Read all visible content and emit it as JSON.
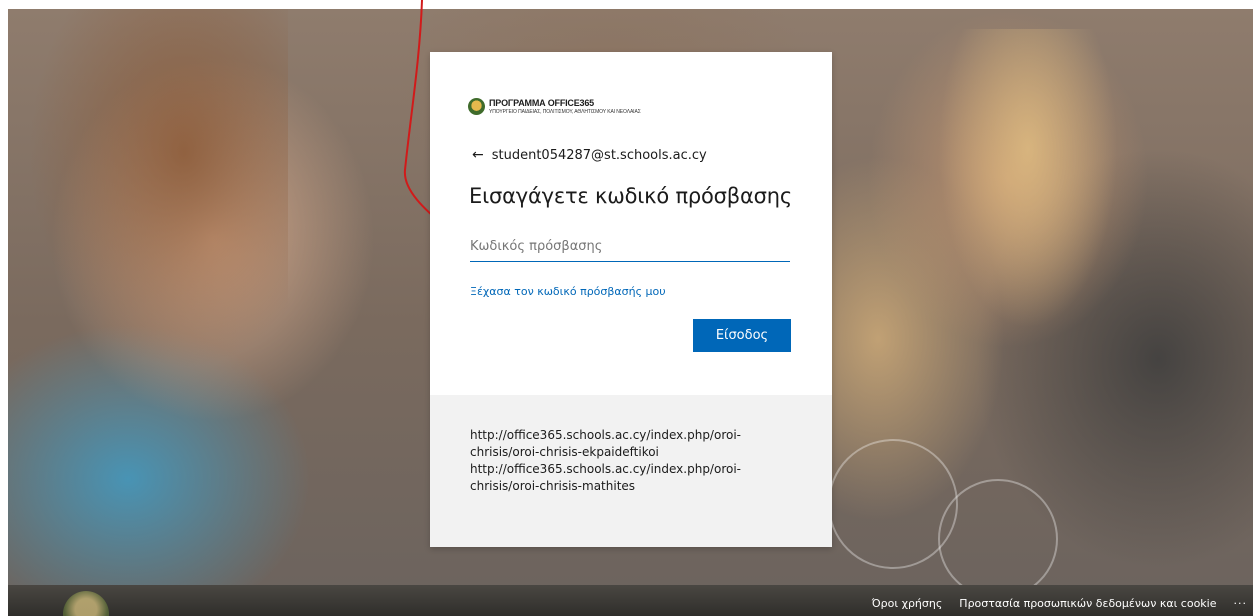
{
  "brand": {
    "title": "ΠΡΟΓΡΑΜΜΑ OFFICE365",
    "subtitle": "ΥΠΟΥΡΓΕΙΟ ΠΑΙΔΕΙΑΣ, ΠΟΛΙΤΙΣΜΟΥ, ΑΘΛΗΤΙΣΜΟΥ ΚΑΙ ΝΕΟΛΑΙΑΣ"
  },
  "identity": {
    "back_icon": "back-arrow-icon",
    "email": "student054287@st.schools.ac.cy"
  },
  "heading": "Εισαγάγετε κωδικό πρόσβασης",
  "password": {
    "placeholder": "Κωδικός πρόσβασης",
    "value": ""
  },
  "forgot_link": "Ξέχασα τον κωδικό πρόσβασής μου",
  "signin_label": "Είσοδος",
  "accent_color": "#0067b8",
  "notice": {
    "line1": "http://office365.schools.ac.cy/index.php/oroi-chrisis/oroi-chrisis-ekpaideftikoi",
    "line2": "http://office365.schools.ac.cy/index.php/oroi-chrisis/oroi-chrisis-mathites"
  },
  "footer": {
    "terms": "Όροι χρήσης",
    "privacy": "Προστασία προσωπικών δεδομένων και cookie",
    "more": "···"
  }
}
